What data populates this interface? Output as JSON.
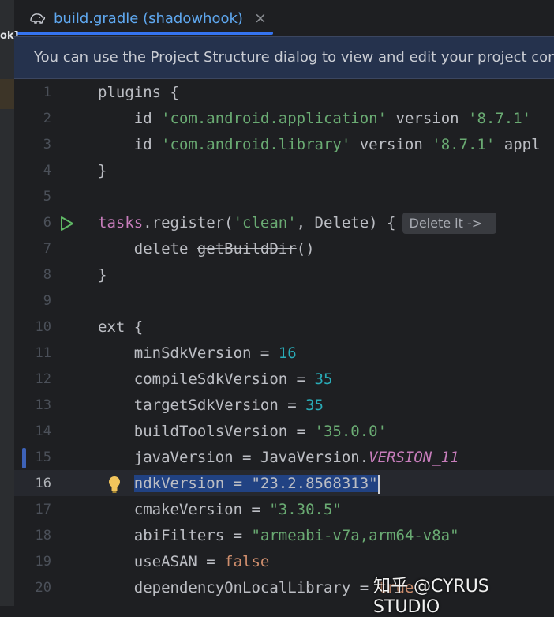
{
  "tab": {
    "title": "build.gradle (shadowhook)",
    "close": "×"
  },
  "left_strip": {
    "label": "ok]"
  },
  "banner": {
    "text": "You can use the Project Structure dialog to view and edit your project configu"
  },
  "lines": [
    {
      "n": "1",
      "code": [
        [
          "plain",
          "plugins {"
        ]
      ]
    },
    {
      "n": "2",
      "code": [
        [
          "plain",
          "    id "
        ],
        [
          "str",
          "'com.android.application'"
        ],
        [
          "plain",
          " version "
        ],
        [
          "str",
          "'8.7.1'"
        ]
      ]
    },
    {
      "n": "3",
      "code": [
        [
          "plain",
          "    id "
        ],
        [
          "str",
          "'com.android.library'"
        ],
        [
          "plain",
          " version "
        ],
        [
          "str",
          "'8.7.1'"
        ],
        [
          "plain",
          " appl"
        ]
      ]
    },
    {
      "n": "4",
      "code": [
        [
          "plain",
          "}"
        ]
      ]
    },
    {
      "n": "5",
      "code": []
    },
    {
      "n": "6",
      "code": [
        [
          "fn",
          "tasks"
        ],
        [
          "plain",
          ".register("
        ],
        [
          "str",
          "'clean'"
        ],
        [
          "plain",
          ", Delete) {"
        ]
      ]
    },
    {
      "n": "7",
      "code": [
        [
          "plain",
          "    delete "
        ],
        [
          "strike",
          "getBuildDir"
        ],
        [
          "plain",
          "()"
        ]
      ]
    },
    {
      "n": "8",
      "code": [
        [
          "plain",
          "}"
        ]
      ]
    },
    {
      "n": "9",
      "code": []
    },
    {
      "n": "10",
      "code": [
        [
          "plain",
          "ext {"
        ]
      ]
    },
    {
      "n": "11",
      "code": [
        [
          "plain",
          "    minSdkVersion = "
        ],
        [
          "num",
          "16"
        ]
      ]
    },
    {
      "n": "12",
      "code": [
        [
          "plain",
          "    compileSdkVersion = "
        ],
        [
          "num",
          "35"
        ]
      ]
    },
    {
      "n": "13",
      "code": [
        [
          "plain",
          "    targetSdkVersion = "
        ],
        [
          "num",
          "35"
        ]
      ]
    },
    {
      "n": "14",
      "code": [
        [
          "plain",
          "    buildToolsVersion = "
        ],
        [
          "str",
          "'35.0.0'"
        ]
      ]
    },
    {
      "n": "15",
      "code": [
        [
          "plain",
          "    javaVersion = JavaVersion."
        ],
        [
          "const",
          "VERSION_11"
        ]
      ]
    },
    {
      "n": "16",
      "code": [
        [
          "plain",
          "    "
        ],
        [
          "sel",
          "ndkVersion = \"23.2.8568313\""
        ]
      ]
    },
    {
      "n": "17",
      "code": [
        [
          "plain",
          "    cmakeVersion = "
        ],
        [
          "str",
          "\"3.30.5\""
        ]
      ]
    },
    {
      "n": "18",
      "code": [
        [
          "plain",
          "    abiFilters = "
        ],
        [
          "str",
          "\"armeabi-v7a,arm64-v8a\""
        ]
      ]
    },
    {
      "n": "19",
      "code": [
        [
          "plain",
          "    useASAN = "
        ],
        [
          "kw",
          "false"
        ]
      ]
    },
    {
      "n": "20",
      "code": [
        [
          "plain",
          "    dependencyOnLocalLibrary = "
        ],
        [
          "kw",
          "true"
        ]
      ]
    }
  ],
  "inlay_hint": "Delete it ->",
  "watermark": "知乎 @CYRUS STUDIO",
  "icons": {
    "run": "run-gutter-icon",
    "bulb": "lightbulb-icon",
    "elephant": "gradle-elephant-icon"
  },
  "colors": {
    "accent": "#3574f0",
    "string": "#6aab73",
    "number": "#2aacb8",
    "keyword": "#cf8e6d",
    "selection": "#214283"
  }
}
